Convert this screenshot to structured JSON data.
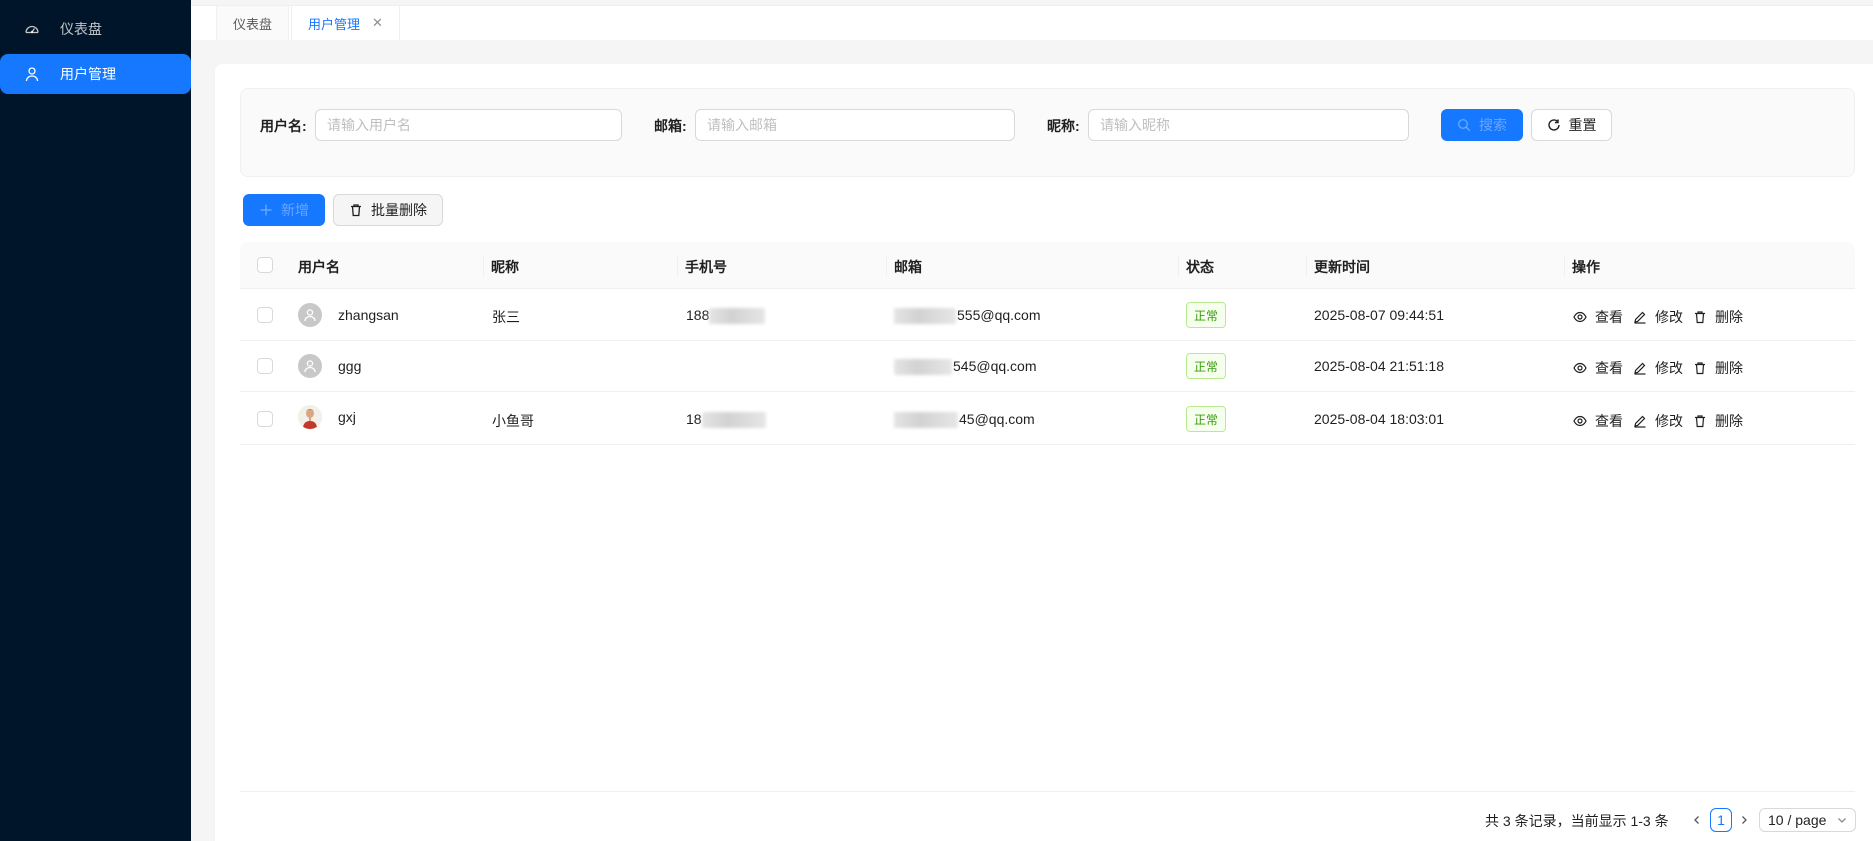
{
  "sidebar": {
    "items": [
      {
        "label": "仪表盘",
        "icon": "dashboard-icon",
        "active": false
      },
      {
        "label": "用户管理",
        "icon": "user-icon",
        "active": true
      }
    ]
  },
  "tabs": [
    {
      "label": "仪表盘",
      "active": false
    },
    {
      "label": "用户管理",
      "active": true,
      "closable": true
    }
  ],
  "search": {
    "username_label": "用户名:",
    "username_placeholder": "请输入用户名",
    "email_label": "邮箱:",
    "email_placeholder": "请输入邮箱",
    "nickname_label": "昵称:",
    "nickname_placeholder": "请输入昵称",
    "search_button": "搜索",
    "reset_button": "重置"
  },
  "toolbar": {
    "add_button": "新增",
    "batch_delete_button": "批量删除"
  },
  "table": {
    "columns": [
      "用户名",
      "昵称",
      "手机号",
      "邮箱",
      "状态",
      "更新时间",
      "操作"
    ],
    "rows": [
      {
        "username": "zhangsan",
        "nickname": "张三",
        "phone_visible": "188",
        "email_visible": "555@qq.com",
        "status": "正常",
        "updated": "2025-08-07 09:44:51",
        "avatar": "default"
      },
      {
        "username": "ggg",
        "nickname": "",
        "phone_visible": "",
        "email_visible": "545@qq.com",
        "status": "正常",
        "updated": "2025-08-04 21:51:18",
        "avatar": "default"
      },
      {
        "username": "gxj",
        "nickname": "小鱼哥",
        "phone_visible": "18",
        "email_visible": "45@qq.com",
        "status": "正常",
        "updated": "2025-08-04 18:03:01",
        "avatar": "photo"
      }
    ],
    "actions": {
      "view": "查看",
      "edit": "修改",
      "delete": "删除"
    }
  },
  "pagination": {
    "summary": "共 3 条记录，当前显示 1-3 条",
    "current_page": "1",
    "page_size": "10 / page"
  },
  "colors": {
    "primary": "#1677ff",
    "sidebar_bg": "#001529",
    "success": "#389e0d"
  }
}
